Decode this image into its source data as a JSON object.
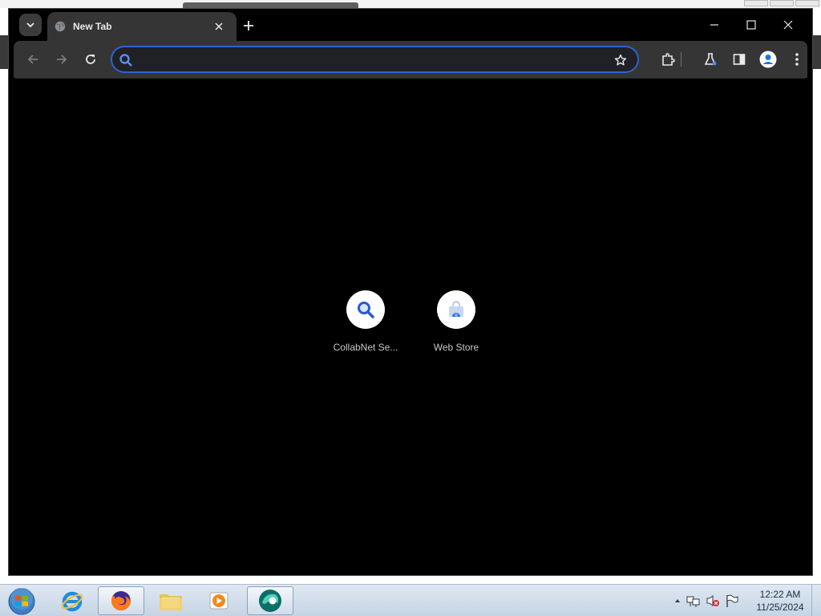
{
  "browser": {
    "tab": {
      "title": "New Tab"
    },
    "omnibox": {
      "value": "",
      "placeholder": ""
    }
  },
  "shortcuts": [
    {
      "label": "CollabNet Se...",
      "icon": "search-icon"
    },
    {
      "label": "Web Store",
      "icon": "web-store-icon"
    }
  ],
  "taskbar": {
    "apps": [
      "internet-explorer-icon",
      "firefox-icon",
      "file-explorer-icon",
      "media-player-icon",
      "browser-app-icon"
    ],
    "clock": {
      "time": "12:22 AM",
      "date": "11/25/2024"
    }
  },
  "colors": {
    "focus_ring": "#2a63d6",
    "tab_bg": "#353535",
    "page_bg": "#000000",
    "accent_blue": "#1a73e8"
  }
}
